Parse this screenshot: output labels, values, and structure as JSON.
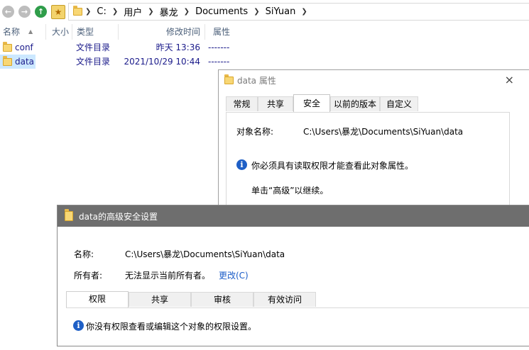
{
  "explorer": {
    "breadcrumbs": [
      "C:",
      "用户",
      "暴龙",
      "Documents",
      "SiYuan"
    ],
    "columns": {
      "name": "名称",
      "size": "大小",
      "type": "类型",
      "modified": "修改时间",
      "attributes": "属性"
    },
    "rows": [
      {
        "name": "conf",
        "type": "文件目录",
        "modified": "昨天  13:36",
        "attributes": "-------",
        "selected": false
      },
      {
        "name": "data",
        "type": "文件目录",
        "modified": "2021/10/29  10:44",
        "attributes": "-------",
        "selected": true
      }
    ]
  },
  "properties": {
    "title": "data 属性",
    "close_glyph": "×",
    "tabs": [
      "常规",
      "共享",
      "安全",
      "以前的版本",
      "自定义"
    ],
    "active_tab": "安全",
    "object_name_label": "对象名称:",
    "object_name_value": "C:\\Users\\暴龙\\Documents\\SiYuan\\data",
    "info_message": "你必须具有读取权限才能查看此对象属性。",
    "advanced_hint": "单击“高级”以继续。"
  },
  "advanced": {
    "title": "data的高级安全设置",
    "name_label": "名称:",
    "name_value": "C:\\Users\\暴龙\\Documents\\SiYuan\\data",
    "owner_label": "所有者:",
    "owner_value": "无法显示当前所有者。",
    "change_link": "更改(C)",
    "tabs": [
      "权限",
      "共享",
      "审核",
      "有效访问"
    ],
    "active_tab": "权限",
    "info_message": "你没有权限查看或编辑这个对象的权限设置。"
  },
  "colors": {
    "accent": "#1a5cc8",
    "selection": "#cce8ff",
    "title_bar_inactive": "#6e6e6e"
  }
}
